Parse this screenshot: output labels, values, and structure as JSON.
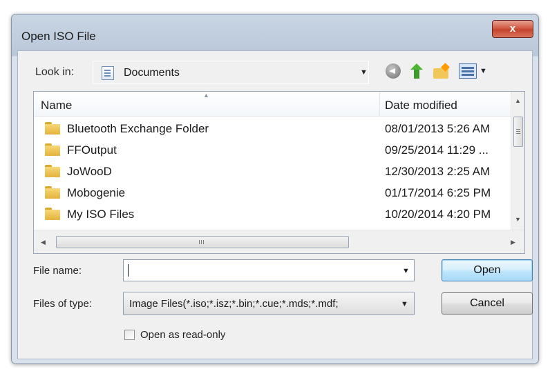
{
  "window": {
    "title": "Open ISO File",
    "close_label": "x"
  },
  "lookin": {
    "label": "Look in:",
    "value": "Documents",
    "icon": "documents-library-icon"
  },
  "toolbar": {
    "icons": [
      "back-icon",
      "up-folder-icon",
      "new-folder-icon",
      "view-menu-icon"
    ]
  },
  "list": {
    "columns": {
      "name": "Name",
      "date": "Date modified"
    },
    "items": [
      {
        "name": "Bluetooth Exchange Folder",
        "date": "08/01/2013 5:26 AM"
      },
      {
        "name": "FFOutput",
        "date": "09/25/2014 11:29 ..."
      },
      {
        "name": "JoWooD",
        "date": "12/30/2013 2:25 AM"
      },
      {
        "name": "Mobogenie",
        "date": "01/17/2014 6:25 PM"
      },
      {
        "name": "My ISO Files",
        "date": "10/20/2014 4:20 PM"
      }
    ],
    "hscroll_grip": "III"
  },
  "form": {
    "filename_label": "File name:",
    "filename_value": "",
    "filetype_label": "Files of type:",
    "filetype_value": "Image Files(*.iso;*.isz;*.bin;*.cue;*.mds;*.mdf;",
    "readonly_label": "Open as read-only",
    "readonly_checked": false
  },
  "buttons": {
    "open": "Open",
    "cancel": "Cancel"
  },
  "colors": {
    "close_button": "#c4432d",
    "default_button_border": "#3c7fb1",
    "folder": "#e3b23c"
  }
}
